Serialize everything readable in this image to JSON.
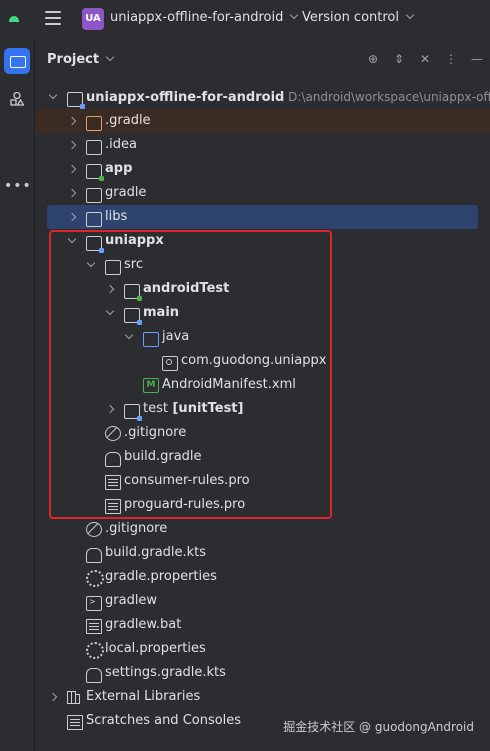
{
  "titlebar": {
    "project_badge": "UA",
    "project_name": "uniappx-offline-for-android",
    "version_control": "Version control"
  },
  "panel": {
    "title": "Project"
  },
  "tree": [
    {
      "label": "uniappx-offline-for-android",
      "extra": "D:\\android\\workspace\\uniappx-offline",
      "indent": 0,
      "arrow": "down",
      "icon": "module",
      "bold": true
    },
    {
      "label": ".gradle",
      "indent": 1,
      "arrow": "right",
      "icon": "folder-orange",
      "bg": "exclude"
    },
    {
      "label": ".idea",
      "indent": 1,
      "arrow": "right",
      "icon": "folder"
    },
    {
      "label": "app",
      "indent": 1,
      "arrow": "right",
      "icon": "module-green",
      "bold": true
    },
    {
      "label": "gradle",
      "indent": 1,
      "arrow": "right",
      "icon": "folder"
    },
    {
      "label": "libs",
      "indent": 1,
      "arrow": "right",
      "icon": "folder",
      "selected": true
    },
    {
      "label": "uniappx",
      "indent": 1,
      "arrow": "down",
      "icon": "module",
      "bold": true
    },
    {
      "label": "src",
      "indent": 2,
      "arrow": "down",
      "icon": "folder"
    },
    {
      "label": "androidTest",
      "indent": 3,
      "arrow": "right",
      "icon": "module-green",
      "bold": true
    },
    {
      "label": "main",
      "indent": 3,
      "arrow": "down",
      "icon": "module",
      "bold": true
    },
    {
      "label": "java",
      "indent": 4,
      "arrow": "down",
      "icon": "folder-blue"
    },
    {
      "label": "com.guodong.uniappx",
      "indent": 5,
      "arrow": "",
      "icon": "package"
    },
    {
      "label": "AndroidManifest.xml",
      "indent": 4,
      "arrow": "",
      "icon": "manifest",
      "icon_letter": "M"
    },
    {
      "label": "test",
      "suffix": "[unitTest]",
      "indent": 3,
      "arrow": "right",
      "icon": "module"
    },
    {
      "label": ".gitignore",
      "indent": 2,
      "arrow": "",
      "icon": "ban"
    },
    {
      "label": "build.gradle",
      "indent": 2,
      "arrow": "",
      "icon": "elephant"
    },
    {
      "label": "consumer-rules.pro",
      "indent": 2,
      "arrow": "",
      "icon": "text"
    },
    {
      "label": "proguard-rules.pro",
      "indent": 2,
      "arrow": "",
      "icon": "text"
    },
    {
      "label": ".gitignore",
      "indent": 1,
      "arrow": "",
      "icon": "ban"
    },
    {
      "label": "build.gradle.kts",
      "indent": 1,
      "arrow": "",
      "icon": "elephant"
    },
    {
      "label": "gradle.properties",
      "indent": 1,
      "arrow": "",
      "icon": "gear"
    },
    {
      "label": "gradlew",
      "indent": 1,
      "arrow": "",
      "icon": "terminal"
    },
    {
      "label": "gradlew.bat",
      "indent": 1,
      "arrow": "",
      "icon": "text"
    },
    {
      "label": "local.properties",
      "indent": 1,
      "arrow": "",
      "icon": "gear"
    },
    {
      "label": "settings.gradle.kts",
      "indent": 1,
      "arrow": "",
      "icon": "elephant"
    },
    {
      "label": "External Libraries",
      "indent": 0,
      "arrow": "right",
      "icon": "library"
    },
    {
      "label": "Scratches and Consoles",
      "indent": 0,
      "arrow": "",
      "icon": "text"
    }
  ],
  "watermark": "掘金技术社区 @ guodongAndroid"
}
